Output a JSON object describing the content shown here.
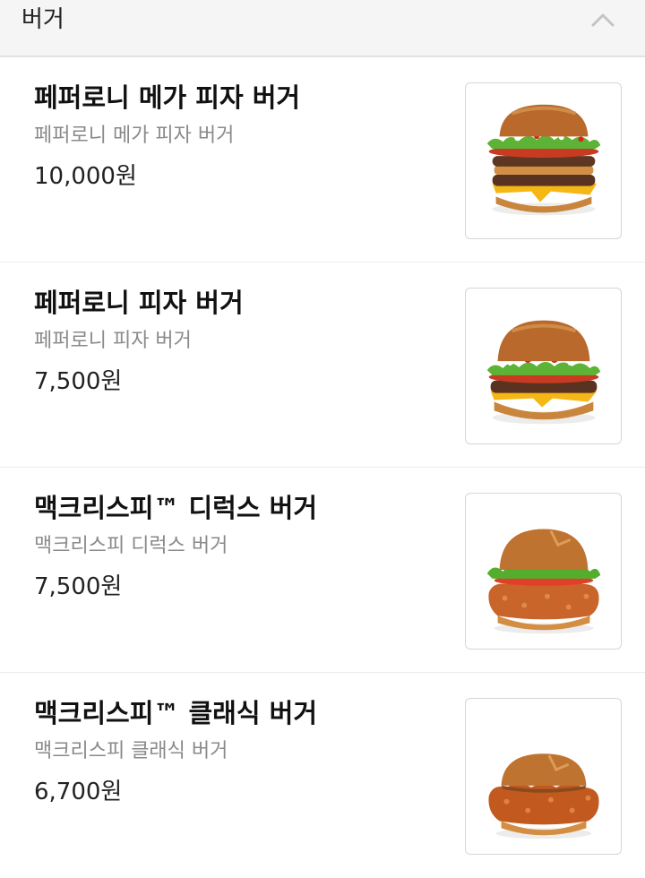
{
  "category": {
    "title": "버거",
    "toggle_icon": "chevron-up-icon"
  },
  "menu": {
    "items": [
      {
        "name": "페퍼로니 메가 피자 버거",
        "description": "페퍼로니 메가 피자 버거",
        "price": "10,000원",
        "image_icon": "double-pepperoni-burger-image"
      },
      {
        "name": "페퍼로니 피자 버거",
        "description": "페퍼로니 피자 버거",
        "price": "7,500원",
        "image_icon": "pepperoni-burger-image"
      },
      {
        "name": "맥크리스피™ 디럭스 버거",
        "description": "맥크리스피 디럭스 버거",
        "price": "7,500원",
        "image_icon": "crispy-chicken-deluxe-burger-image"
      },
      {
        "name": "맥크리스피™ 클래식 버거",
        "description": "맥크리스피 클래식 버거",
        "price": "6,700원",
        "image_icon": "crispy-chicken-classic-burger-image"
      }
    ]
  },
  "colors": {
    "header_bg": "#f5f5f5",
    "price_text": "#222222",
    "description_text": "#8a8a8a"
  }
}
